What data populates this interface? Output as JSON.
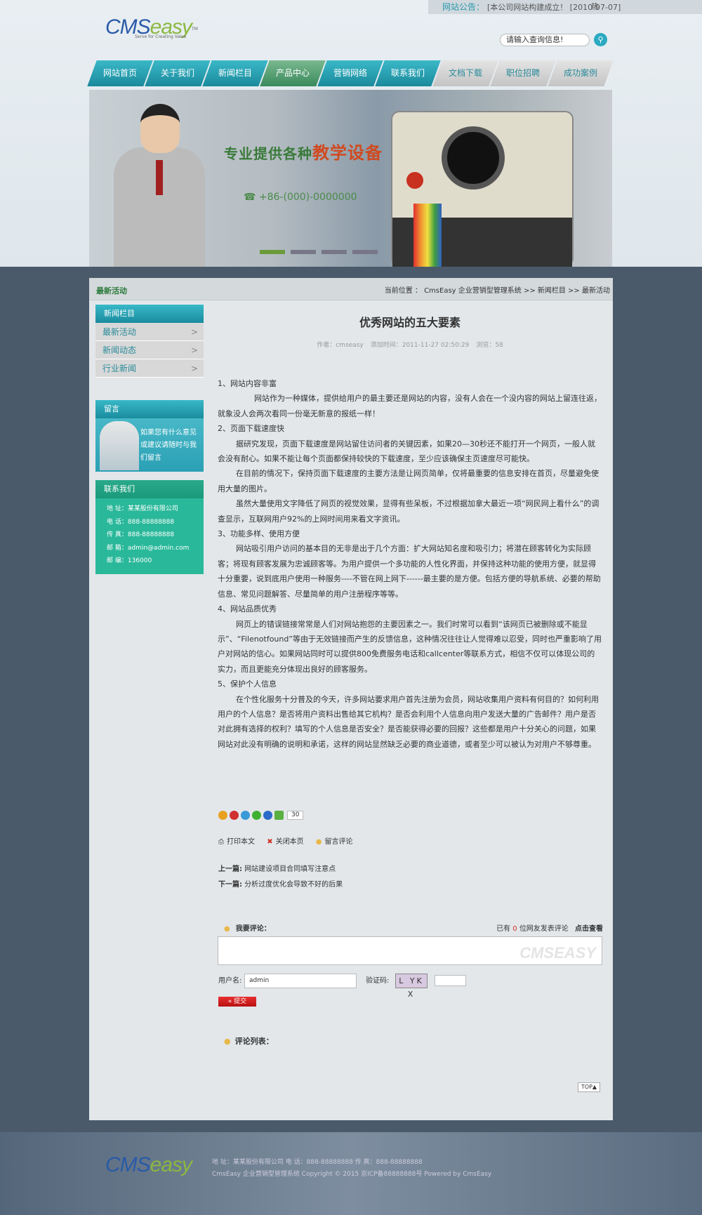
{
  "notice": {
    "label": "网站公告：",
    "text": "[本公司网站构建成立！ [2010-07-07]",
    "tail": "热"
  },
  "logo": {
    "main_a": "CMS",
    "main_b": "easy",
    "sub": "Serve for Creating Value",
    "tm": "TM"
  },
  "search": {
    "value": "请输入查询信息!"
  },
  "nav": [
    {
      "label": "网站首页"
    },
    {
      "label": "关于我们"
    },
    {
      "label": "新闻栏目"
    },
    {
      "label": "产品中心"
    },
    {
      "label": "营销网络"
    },
    {
      "label": "联系我们"
    },
    {
      "label": "文档下载"
    },
    {
      "label": "职位招聘"
    },
    {
      "label": "成功案例"
    }
  ],
  "banner": {
    "line1_a": "专业提供各种",
    "line1_b": "教学设备",
    "line2": "☎ +86-(000)-0000000"
  },
  "crumb": {
    "title": "最新活动",
    "path": "当前位置 ： CmsEasy 企业营销型管理系统 >> 新闻栏目 >> 最新活动"
  },
  "sidebar": {
    "title": "新闻栏目",
    "items": [
      {
        "label": "最新活动"
      },
      {
        "label": "新闻动态"
      },
      {
        "label": "行业新闻"
      }
    ]
  },
  "message": {
    "title": "留言",
    "text": "如果您有什么意见或建议请随时与我们留言"
  },
  "contact": {
    "title": "联系我们",
    "lines": [
      "地 址：某某股份有限公司",
      "电 话：888-88888888",
      "传 真：888-88888888",
      "邮 箱：admin@admin.com",
      "邮 编：136000"
    ]
  },
  "article": {
    "title": "优秀网站的五大要素",
    "author": "作者：cmseasy",
    "time": "添加时间：2011-11-27 02:50:29",
    "views": "浏览：58",
    "paras": [
      {
        "t": "1、网站内容非富",
        "c": ""
      },
      {
        "t": "网站作为一种媒体，提供给用户的最主要还是网站的内容，没有人会在一个没内容的网站上留连往返，就象没人会两次看同一份毫无新意的报纸一样！",
        "c": "ind2"
      },
      {
        "t": "2、页面下载速度快",
        "c": ""
      },
      {
        "t": "据研究发现，页面下载速度是网站留住访问者的关键因素，如果20—30秒还不能打开一个网页，一般人就会没有耐心。如果不能让每个页面都保持较快的下载速度，至少应该确保主页速度尽可能快。",
        "c": "ind"
      },
      {
        "t": "在目前的情况下，保持页面下载速度的主要方法是让网页简单，仅将最重要的信息安排在首页，尽量避免使用大量的图片。",
        "c": "ind"
      },
      {
        "t": "虽然大量使用文字降低了网页的视觉效果，显得有些呆板，不过根据加拿大最近一项“网民网上看什么”的调查显示，互联网用户92%的上网时间用来看文字资讯。",
        "c": "ind"
      },
      {
        "t": "3、功能多样、使用方便",
        "c": ""
      },
      {
        "t": "网站吸引用户访问的基本目的无非是出于几个方面：扩大网站知名度和吸引力；将潜在顾客转化为实际顾客；将现有顾客发展为忠诚顾客等。为用户提供一个多功能的人性化界面，并保持这种功能的使用方便，就显得十分重要，说到底用户使用一种服务----不管在网上网下------最主要的是方便。包括方便的导航系统、必要的帮助信息、常见问题解答、尽量简单的用户注册程序等等。",
        "c": "ind"
      },
      {
        "t": "4、网站品质优秀",
        "c": ""
      },
      {
        "t": "网页上的错误链接常常是人们对网站抱怨的主要因素之一。我们时常可以看到“该网页已被删除或不能显示”、“Filenotfound”等由于无效链接而产生的反馈信息，这种情况往往让人觉得难以忍受，同时也严重影响了用户对网站的信心。如果网站同时可以提供800免费服务电话和callcenter等联系方式，相信不仅可以体现公司的实力，而且更能充分体现出良好的顾客服务。",
        "c": "ind"
      },
      {
        "t": "5、保护个人信息",
        "c": ""
      },
      {
        "t": "在个性化服务十分普及的今天，许多网站要求用户首先注册为会员，网站收集用户资料有何目的？如何利用用户的个人信息？是否将用户资料出售给其它机构？是否会利用个人信息向用户发送大量的广告邮件？用户是否对此拥有选择的权利？填写的个人信息是否安全？是否能获得必要的回报？这些都是用户十分关心的问题，如果网站对此没有明确的说明和承诺，这样的网站显然缺乏必要的商业道德，或者至少可以被认为对用户不够尊重。",
        "c": "ind"
      }
    ]
  },
  "share": {
    "count": "30"
  },
  "tools": {
    "print": "打印本文",
    "close": "关闭本页",
    "comment": "留言评论"
  },
  "prevnext": {
    "prev_label": "上一篇:",
    "prev": "网站建设项目合同填写注意点",
    "next_label": "下一篇:",
    "next": "分析过度优化会导致不好的后果"
  },
  "comment": {
    "title": "我要评论：",
    "count_pre": "已有",
    "count": "0",
    "count_post": "位网友发表评论",
    "view": "点击查看",
    "watermark": "CMSEASY",
    "user_label": "用户名:",
    "user_value": "admin",
    "code_label": "验证码:",
    "code_img": "L YK X",
    "submit": "提交",
    "list_title": "评论列表："
  },
  "top": "TOP▲",
  "footer": {
    "info1": "地 址：某某股份有限公司   电 话：888-88888888   传 真：888-88888888",
    "info2": "CmsEasy 企业营销型管理系统 Copyright © 2015  京ICP备88888888号  Powered by CmsEasy"
  }
}
